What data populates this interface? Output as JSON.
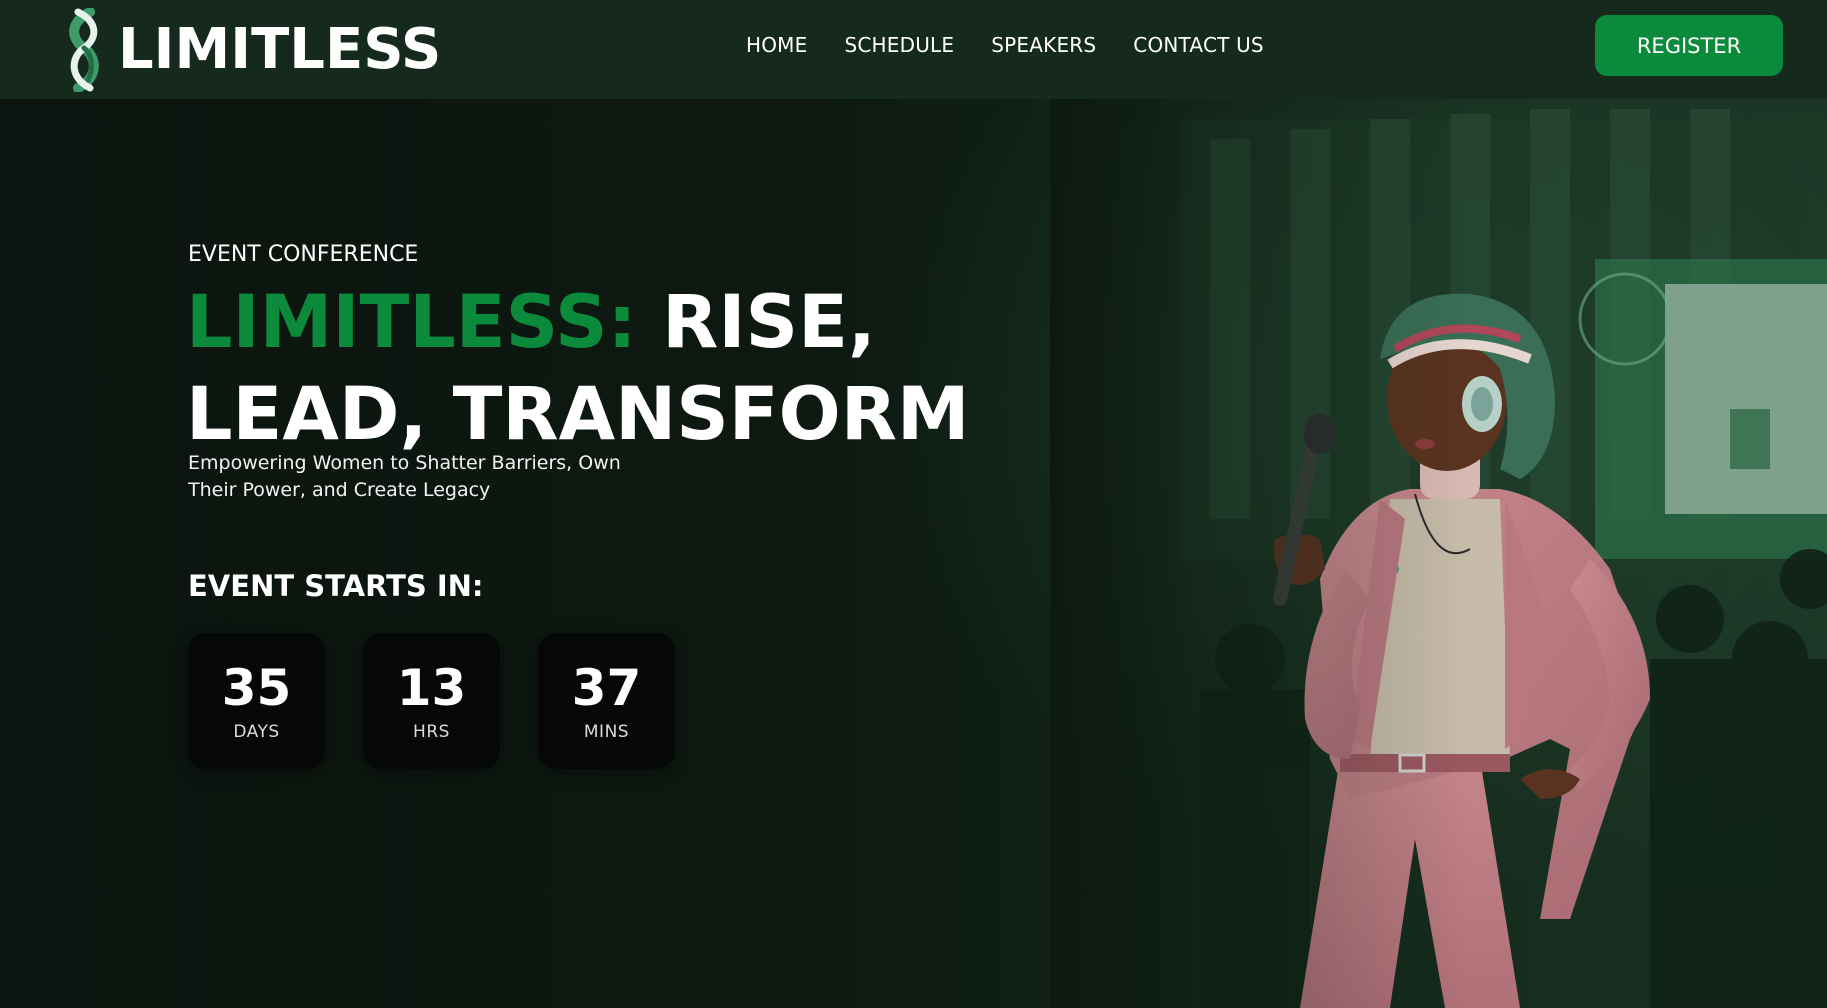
{
  "header": {
    "brand": "LIMITLESS",
    "nav": [
      "HOME",
      "SCHEDULE",
      "SPEAKERS",
      "CONTACT US"
    ],
    "register_label": "REGISTER"
  },
  "hero": {
    "eyebrow": "EVENT CONFERENCE",
    "headline_accent": "LIMITLESS:",
    "headline_rest": "RISE, LEAD, TRANSFORM",
    "subtitle": "Empowering Women to Shatter Barriers, Own Their Power, and Create Legacy",
    "countdown_heading": "EVENT STARTS IN:",
    "countdown": [
      {
        "value": "35",
        "unit": "DAYS"
      },
      {
        "value": "13",
        "unit": "HRS"
      },
      {
        "value": "37",
        "unit": "MINS"
      }
    ]
  },
  "colors": {
    "accent": "#0c8a3b",
    "register": "#0a8a3a",
    "header_bg": "#152a1d",
    "hero_bg": "#0d1911"
  },
  "icons": [
    "infinity-logo-icon"
  ]
}
